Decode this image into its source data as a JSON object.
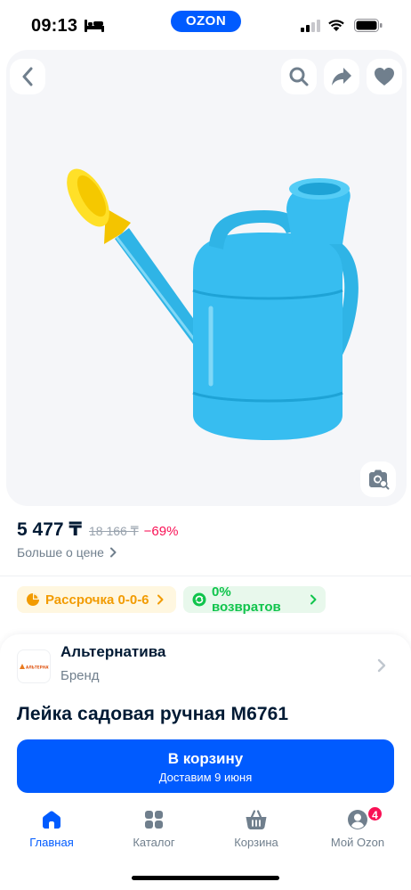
{
  "status_bar": {
    "time": "09:13",
    "app_badge": "OZON"
  },
  "icons": {
    "back": "chevron-left-icon",
    "search": "search-icon",
    "share": "share-arrow-icon",
    "favorite": "heart-icon",
    "visual_search": "camera-search-icon"
  },
  "product": {
    "price_current": "5 477 ₸",
    "price_old": "18 166 ₸",
    "discount": "−69%",
    "more_price_label": "Больше о цене",
    "title": "Лейка садовая ручная М6761"
  },
  "chips": {
    "installment": "Рассрочка 0-0-6",
    "returns": "0% возвратов"
  },
  "brand": {
    "name": "Альтернатива",
    "subtitle": "Бренд",
    "logo_text": "АЛЬТЕРНАТИВА"
  },
  "cart_button": {
    "label": "В корзину",
    "delivery": "Доставим 9 июня"
  },
  "tab_bar": {
    "items": [
      {
        "label": "Главная",
        "active": true
      },
      {
        "label": "Каталог",
        "active": false
      },
      {
        "label": "Корзина",
        "active": false
      },
      {
        "label": "Мой Ozon",
        "active": false,
        "badge": "4"
      }
    ]
  },
  "colors": {
    "accent": "#005bff",
    "discount": "#f91155",
    "installment": "#f29b00",
    "returns": "#10c44c",
    "text_primary": "#001a34",
    "text_secondary": "#707f8d"
  }
}
